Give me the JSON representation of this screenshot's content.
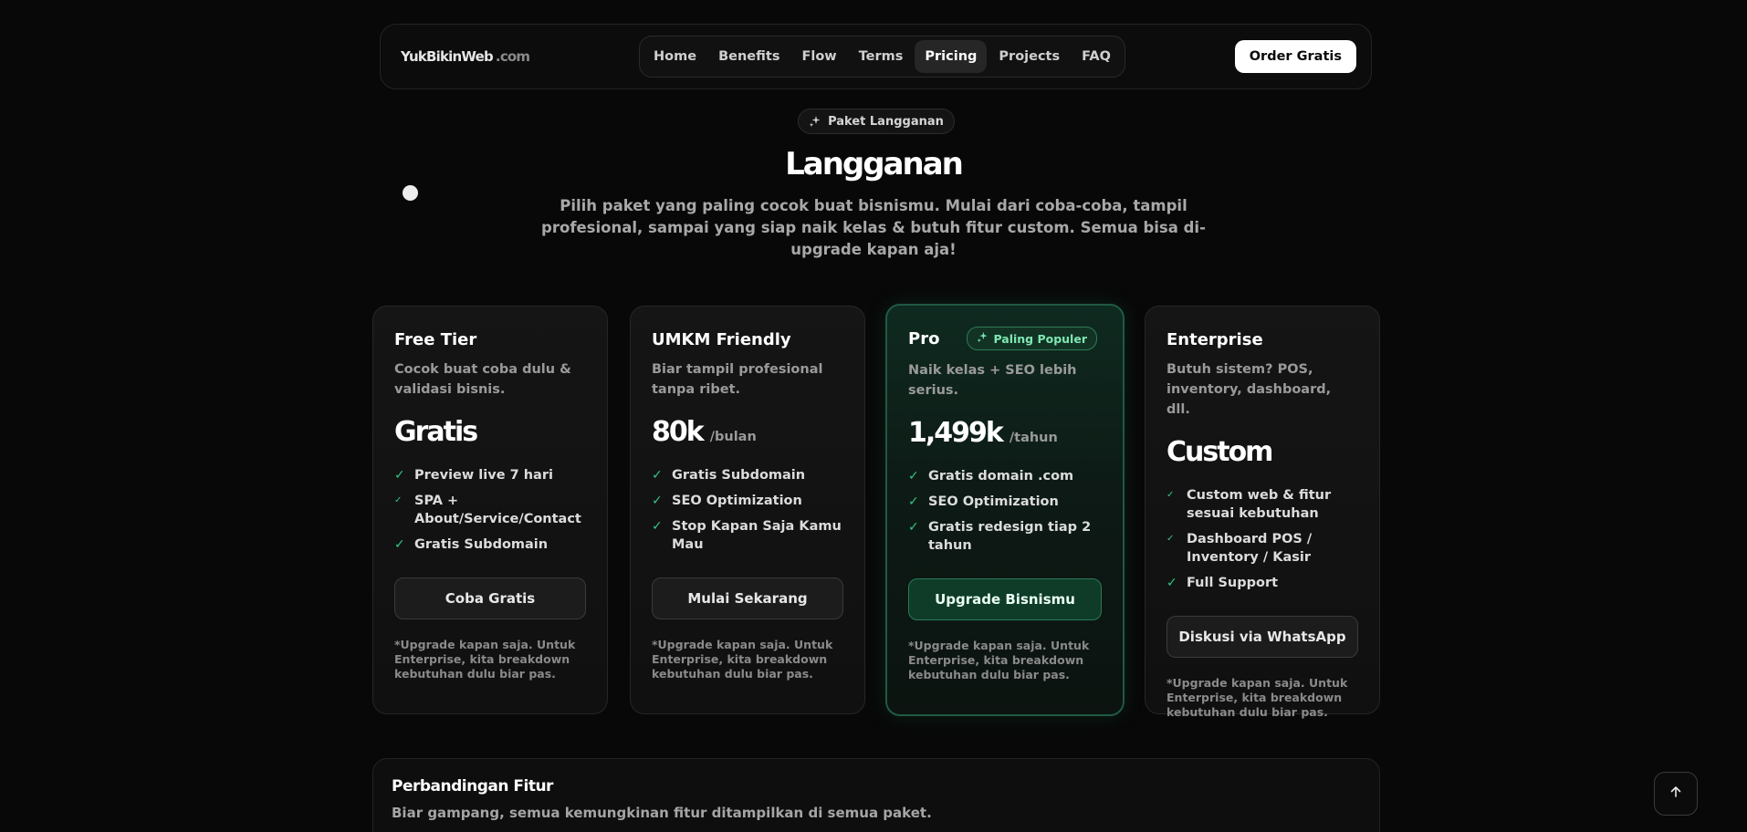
{
  "nav": {
    "logo_main": "YukBikinWeb",
    "logo_ext": ".com",
    "items": [
      "Home",
      "Benefits",
      "Flow",
      "Terms",
      "Pricing",
      "Projects",
      "FAQ"
    ],
    "active": "Pricing",
    "cta": "Order Gratis"
  },
  "hero": {
    "badge": "Paket Langganan",
    "title": "Langganan",
    "subtitle": "Pilih paket yang paling cocok buat bisnismu. Mulai dari coba-coba, tampil profesional, sampai yang siap naik kelas & butuh fitur custom. Semua bisa di-upgrade kapan aja!"
  },
  "plans": [
    {
      "name": "Free Tier",
      "desc": "Cocok buat coba dulu & validasi bisnis.",
      "price": "Gratis",
      "period": "",
      "features": [
        "Preview live 7 hari",
        "SPA + About/Service/Contact",
        "Gratis Subdomain"
      ],
      "cta": "Coba Gratis",
      "note": "*Upgrade kapan saja. Untuk Enterprise, kita breakdown kebutuhan dulu biar pas."
    },
    {
      "name": "UMKM Friendly",
      "desc": "Biar tampil profesional tanpa ribet.",
      "price": "80k",
      "period": "/bulan",
      "features": [
        "Gratis Subdomain",
        "SEO Optimization",
        "Stop Kapan Saja Kamu Mau"
      ],
      "cta": "Mulai Sekarang",
      "note": "*Upgrade kapan saja. Untuk Enterprise, kita breakdown kebutuhan dulu biar pas."
    },
    {
      "name": "Pro",
      "badge": "Paling Populer",
      "desc": "Naik kelas + SEO lebih serius.",
      "price": "1,499k",
      "period": "/tahun",
      "features": [
        "Gratis domain .com",
        "SEO Optimization",
        "Gratis redesign tiap 2 tahun"
      ],
      "cta": "Upgrade Bisnismu",
      "note": "*Upgrade kapan saja. Untuk Enterprise, kita breakdown kebutuhan dulu biar pas."
    },
    {
      "name": "Enterprise",
      "desc": "Butuh sistem? POS, inventory, dashboard, dll.",
      "price": "Custom",
      "period": "",
      "features": [
        "Custom web & fitur sesuai kebutuhan",
        "Dashboard POS / Inventory / Kasir",
        "Full Support"
      ],
      "cta": "Diskusi via WhatsApp",
      "note": "*Upgrade kapan saja. Untuk Enterprise, kita breakdown kebutuhan dulu biar pas."
    }
  ],
  "compare": {
    "title": "Perbandingan Fitur",
    "subtitle": "Biar gampang, semua kemungkinan fitur ditampilkan di semua paket."
  },
  "icons": {
    "sparkle": "sparkle-icon",
    "check": "check-icon",
    "arrow_up": "arrow-up-icon"
  },
  "colors": {
    "accent_green": "#35c483",
    "pro_border": "#1f5a43",
    "background": "#080808"
  }
}
